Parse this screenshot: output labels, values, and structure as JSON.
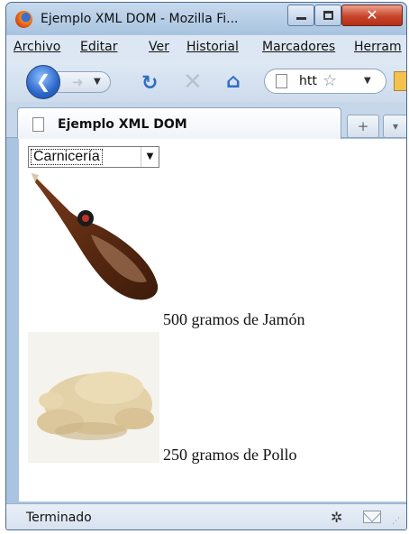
{
  "window": {
    "title": "Ejemplo XML DOM - Mozilla Fi...",
    "close_symbol": "✕"
  },
  "menu": {
    "items": [
      {
        "label": "Archivo"
      },
      {
        "label": "Editar"
      },
      {
        "label": "Ver"
      },
      {
        "label": "Historial"
      },
      {
        "label": "Marcadores"
      },
      {
        "label": "Herram"
      }
    ]
  },
  "toolbar": {
    "url_text": "htt"
  },
  "tab": {
    "title": "Ejemplo XML DOM",
    "new_tab_symbol": "+",
    "list_symbol": "▾"
  },
  "content": {
    "select": {
      "selected": "Carnicería"
    },
    "items": [
      {
        "text": "500 gramos de Jamón",
        "image": "ham-leg"
      },
      {
        "text": "250 gramos de Pollo",
        "image": "raw-chicken"
      }
    ]
  },
  "status": {
    "text": "Terminado"
  },
  "colors": {
    "chrome": "#a9c4e0",
    "close_button": "#c8452a",
    "accent_blue": "#2b67c9"
  },
  "icons": [
    "firefox-logo",
    "back-arrow-icon",
    "forward-arrow-icon",
    "reload-icon",
    "stop-icon",
    "home-icon",
    "page-icon",
    "bookmark-star-icon",
    "bug-icon",
    "mail-icon"
  ]
}
